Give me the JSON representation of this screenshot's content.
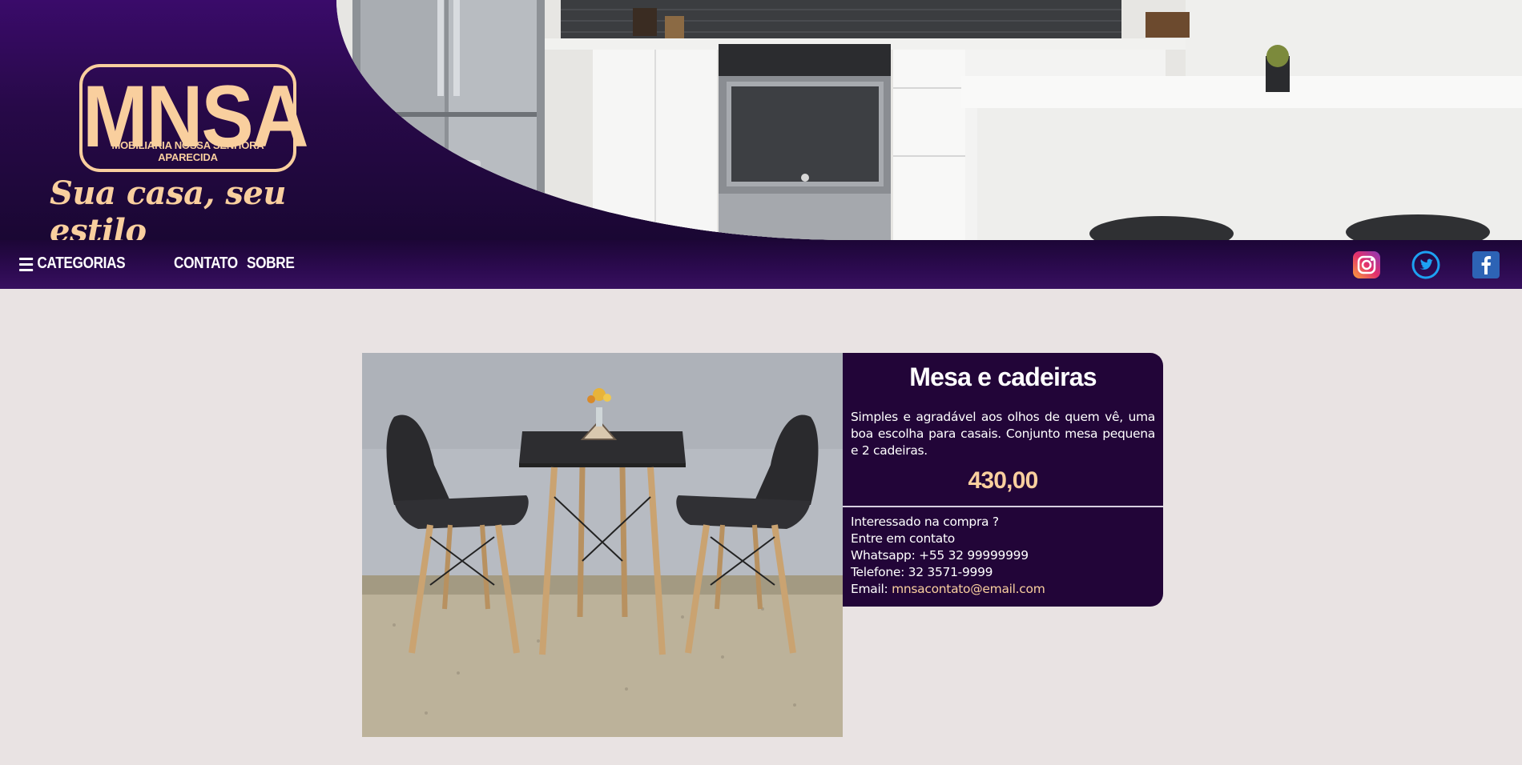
{
  "brand": {
    "logo_letters": "MNSA",
    "logo_subtitle": "MOBILIARIA NOSSA SENHORA APARECIDA",
    "slogan": "Sua casa, seu estilo",
    "accent_color": "#f9cf9e",
    "primary_color": "#270948"
  },
  "nav": {
    "categories_label": "CATEGORIAS",
    "categories_icon": "hamburger-menu-icon",
    "contato_label": "CONTATO",
    "sobre_label": "SOBRE"
  },
  "social": [
    {
      "name": "instagram",
      "icon": "instagram-icon"
    },
    {
      "name": "twitter",
      "icon": "twitter-icon"
    },
    {
      "name": "facebook",
      "icon": "facebook-icon"
    }
  ],
  "product": {
    "title": "Mesa e cadeiras",
    "description": "Simples e agradável aos olhos de quem vê, uma boa escolha para casais. Conjunto mesa pequena e 2 cadeiras.",
    "price": "430,00",
    "contact": {
      "line1": "Interessado na compra ?",
      "line2": "Entre em contato",
      "whatsapp": "Whatsapp: +55 32 99999999",
      "telefone": "Telefone: 32 3571-9999",
      "email_label": "Email: ",
      "email": "mnsacontato@email.com"
    }
  }
}
